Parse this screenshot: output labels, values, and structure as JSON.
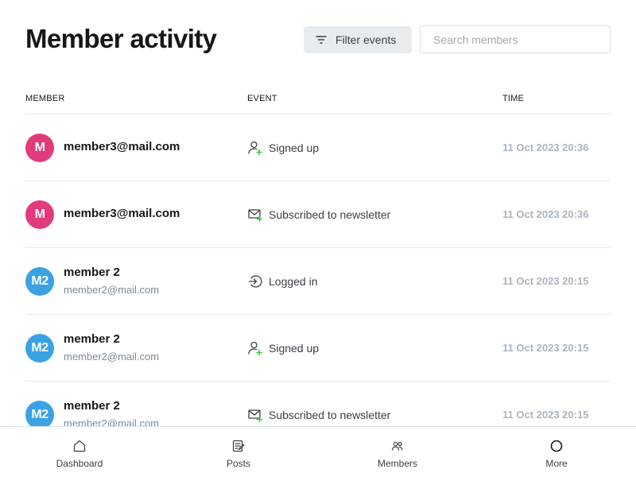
{
  "header": {
    "title": "Member activity",
    "filter_label": "Filter events",
    "search_placeholder": "Search members",
    "search_value": ""
  },
  "table": {
    "columns": [
      "MEMBER",
      "EVENT",
      "TIME"
    ],
    "rows": [
      {
        "initials": "M",
        "avatar_color": "#e23b7d",
        "name": "member3@mail.com",
        "email": "",
        "event_icon": "user-plus-icon",
        "event": "Signed up",
        "time": "11 Oct 2023 20:36"
      },
      {
        "initials": "M",
        "avatar_color": "#e23b7d",
        "name": "member3@mail.com",
        "email": "",
        "event_icon": "mail-plus-icon",
        "event": "Subscribed to newsletter",
        "time": "11 Oct 2023 20:36"
      },
      {
        "initials": "M2",
        "avatar_color": "#3aa2e3",
        "name": "member 2",
        "email": "member2@mail.com",
        "event_icon": "login-icon",
        "event": "Logged in",
        "time": "11 Oct 2023 20:15"
      },
      {
        "initials": "M2",
        "avatar_color": "#3aa2e3",
        "name": "member 2",
        "email": "member2@mail.com",
        "event_icon": "user-plus-icon",
        "event": "Signed up",
        "time": "11 Oct 2023 20:15"
      },
      {
        "initials": "M2",
        "avatar_color": "#3aa2e3",
        "name": "member 2",
        "email": "member2@mail.com",
        "event_icon": "mail-plus-icon",
        "event": "Subscribed to newsletter",
        "time": "11 Oct 2023 20:15"
      }
    ]
  },
  "bottom_nav": {
    "items": [
      {
        "label": "Dashboard",
        "icon": "home-icon"
      },
      {
        "label": "Posts",
        "icon": "posts-icon"
      },
      {
        "label": "Members",
        "icon": "members-icon"
      },
      {
        "label": "More",
        "icon": "more-icon"
      }
    ]
  },
  "colors": {
    "accent_green": "#30cf43",
    "text_primary": "#15171a",
    "text_muted": "#7c8b9a",
    "time_color": "#abb4be",
    "pink_avatar": "#e23b7d",
    "blue_avatar": "#3aa2e3"
  }
}
